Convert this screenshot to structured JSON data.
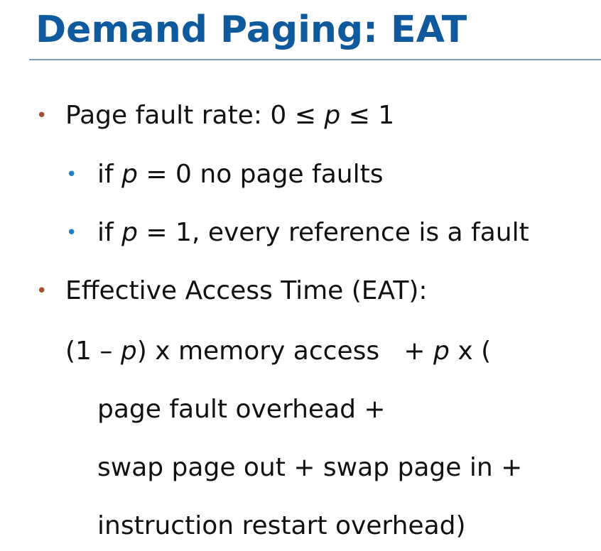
{
  "slide": {
    "title": "Demand Paging: EAT",
    "bullets": {
      "b1": {
        "pre": "Page fault rate: 0 ≤ ",
        "var": "p",
        "post": " ≤ 1"
      },
      "sub1": {
        "pre": "if ",
        "var": "p",
        "post": " = 0 no page faults"
      },
      "sub2": {
        "pre": "if ",
        "var": "p",
        "post": " = 1, every reference is a fault"
      },
      "b2": {
        "text": "Effective Access Time (EAT):"
      }
    },
    "formula": {
      "line1_pre": "(1 – ",
      "line1_var1": "p",
      "line1_mid": ") x memory access   + ",
      "line1_var2": "p",
      "line1_post": " x (",
      "line2": "page fault overhead +",
      "line3": "swap page out + swap page in +",
      "line4": "instruction restart overhead)"
    },
    "bullet_glyph": "•",
    "colors": {
      "title": "#0e5a9c",
      "rule": "#7f9bb6",
      "bullet_level1": "#a0522d",
      "bullet_level2": "#1f7ec8"
    }
  }
}
